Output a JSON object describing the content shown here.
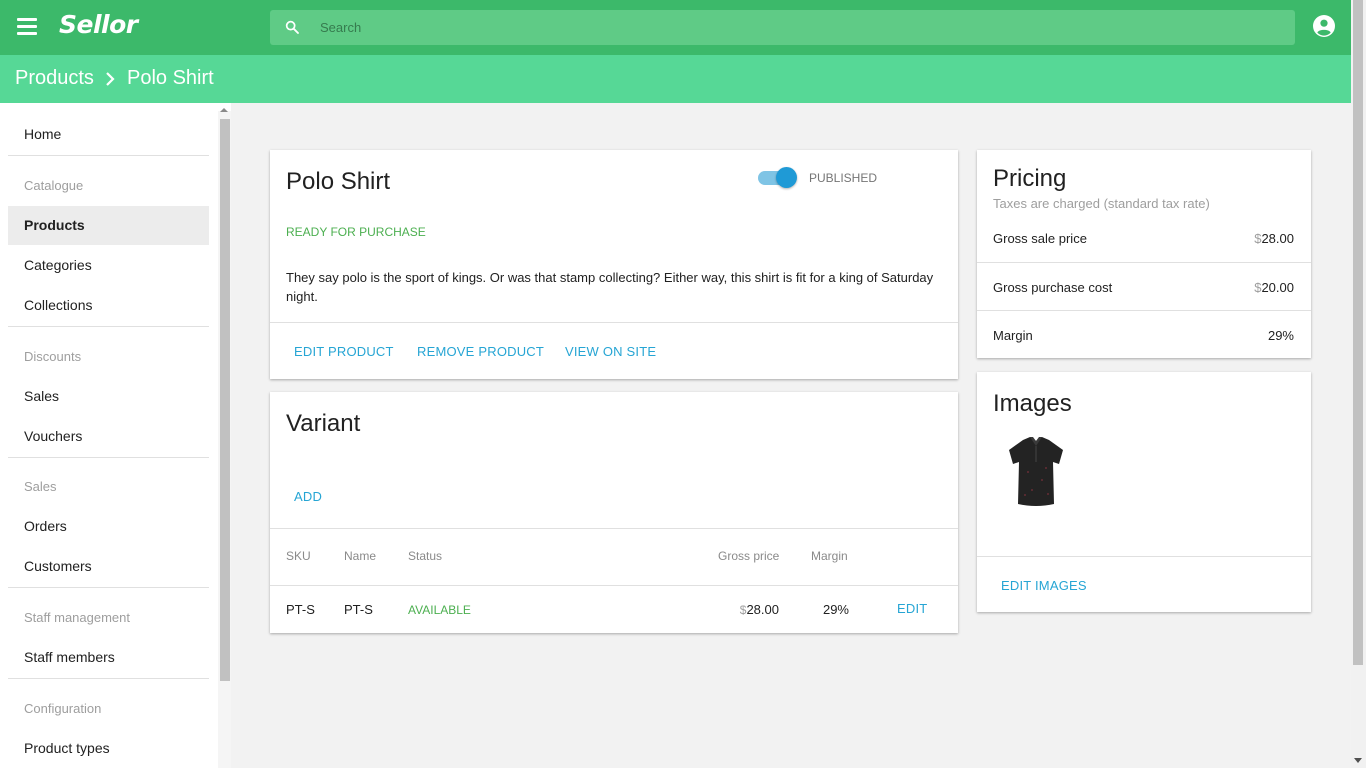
{
  "app": {
    "logo": "Sellor"
  },
  "search": {
    "placeholder": "Search"
  },
  "breadcrumb": {
    "parent": "Products",
    "current": "Polo Shirt"
  },
  "sidebar": {
    "home": "Home",
    "catalogue_header": "Catalogue",
    "products": "Products",
    "categories": "Categories",
    "collections": "Collections",
    "discounts_header": "Discounts",
    "sales_item": "Sales",
    "vouchers": "Vouchers",
    "sales_header": "Sales",
    "orders": "Orders",
    "customers": "Customers",
    "staff_header": "Staff management",
    "staff_members": "Staff members",
    "config_header": "Configuration",
    "product_types": "Product types"
  },
  "product": {
    "title": "Polo Shirt",
    "published": true,
    "published_label": "PUBLISHED",
    "status": "READY FOR PURCHASE",
    "description": "They say polo is the sport of kings. Or was that stamp collecting? Either way, this shirt is fit for a king of Saturday night.",
    "edit_label": "EDIT PRODUCT",
    "remove_label": "REMOVE PRODUCT",
    "view_label": "VIEW ON SITE"
  },
  "variant": {
    "title": "Variant",
    "add_label": "ADD",
    "columns": {
      "sku": "SKU",
      "name": "Name",
      "status": "Status",
      "gross_price": "Gross price",
      "margin": "Margin"
    },
    "rows": [
      {
        "sku": "PT-S",
        "name": "PT-S",
        "status": "AVAILABLE",
        "currency": "$",
        "price": "28.00",
        "margin": "29%",
        "edit": "EDIT"
      }
    ]
  },
  "pricing": {
    "title": "Pricing",
    "subtitle": "Taxes are charged (standard tax rate)",
    "gross_sale_label": "Gross sale price",
    "gross_sale_currency": "$",
    "gross_sale_value": "28.00",
    "gross_purchase_label": "Gross purchase cost",
    "gross_purchase_currency": "$",
    "gross_purchase_value": "20.00",
    "margin_label": "Margin",
    "margin_value": "29%"
  },
  "images": {
    "title": "Images",
    "edit_label": "EDIT IMAGES"
  },
  "colors": {
    "primary": "#3cb96a",
    "breadcrumb_bg": "#56d896",
    "link": "#26a5d4",
    "success": "#4caf50",
    "toggle": "#1f9ad6"
  }
}
